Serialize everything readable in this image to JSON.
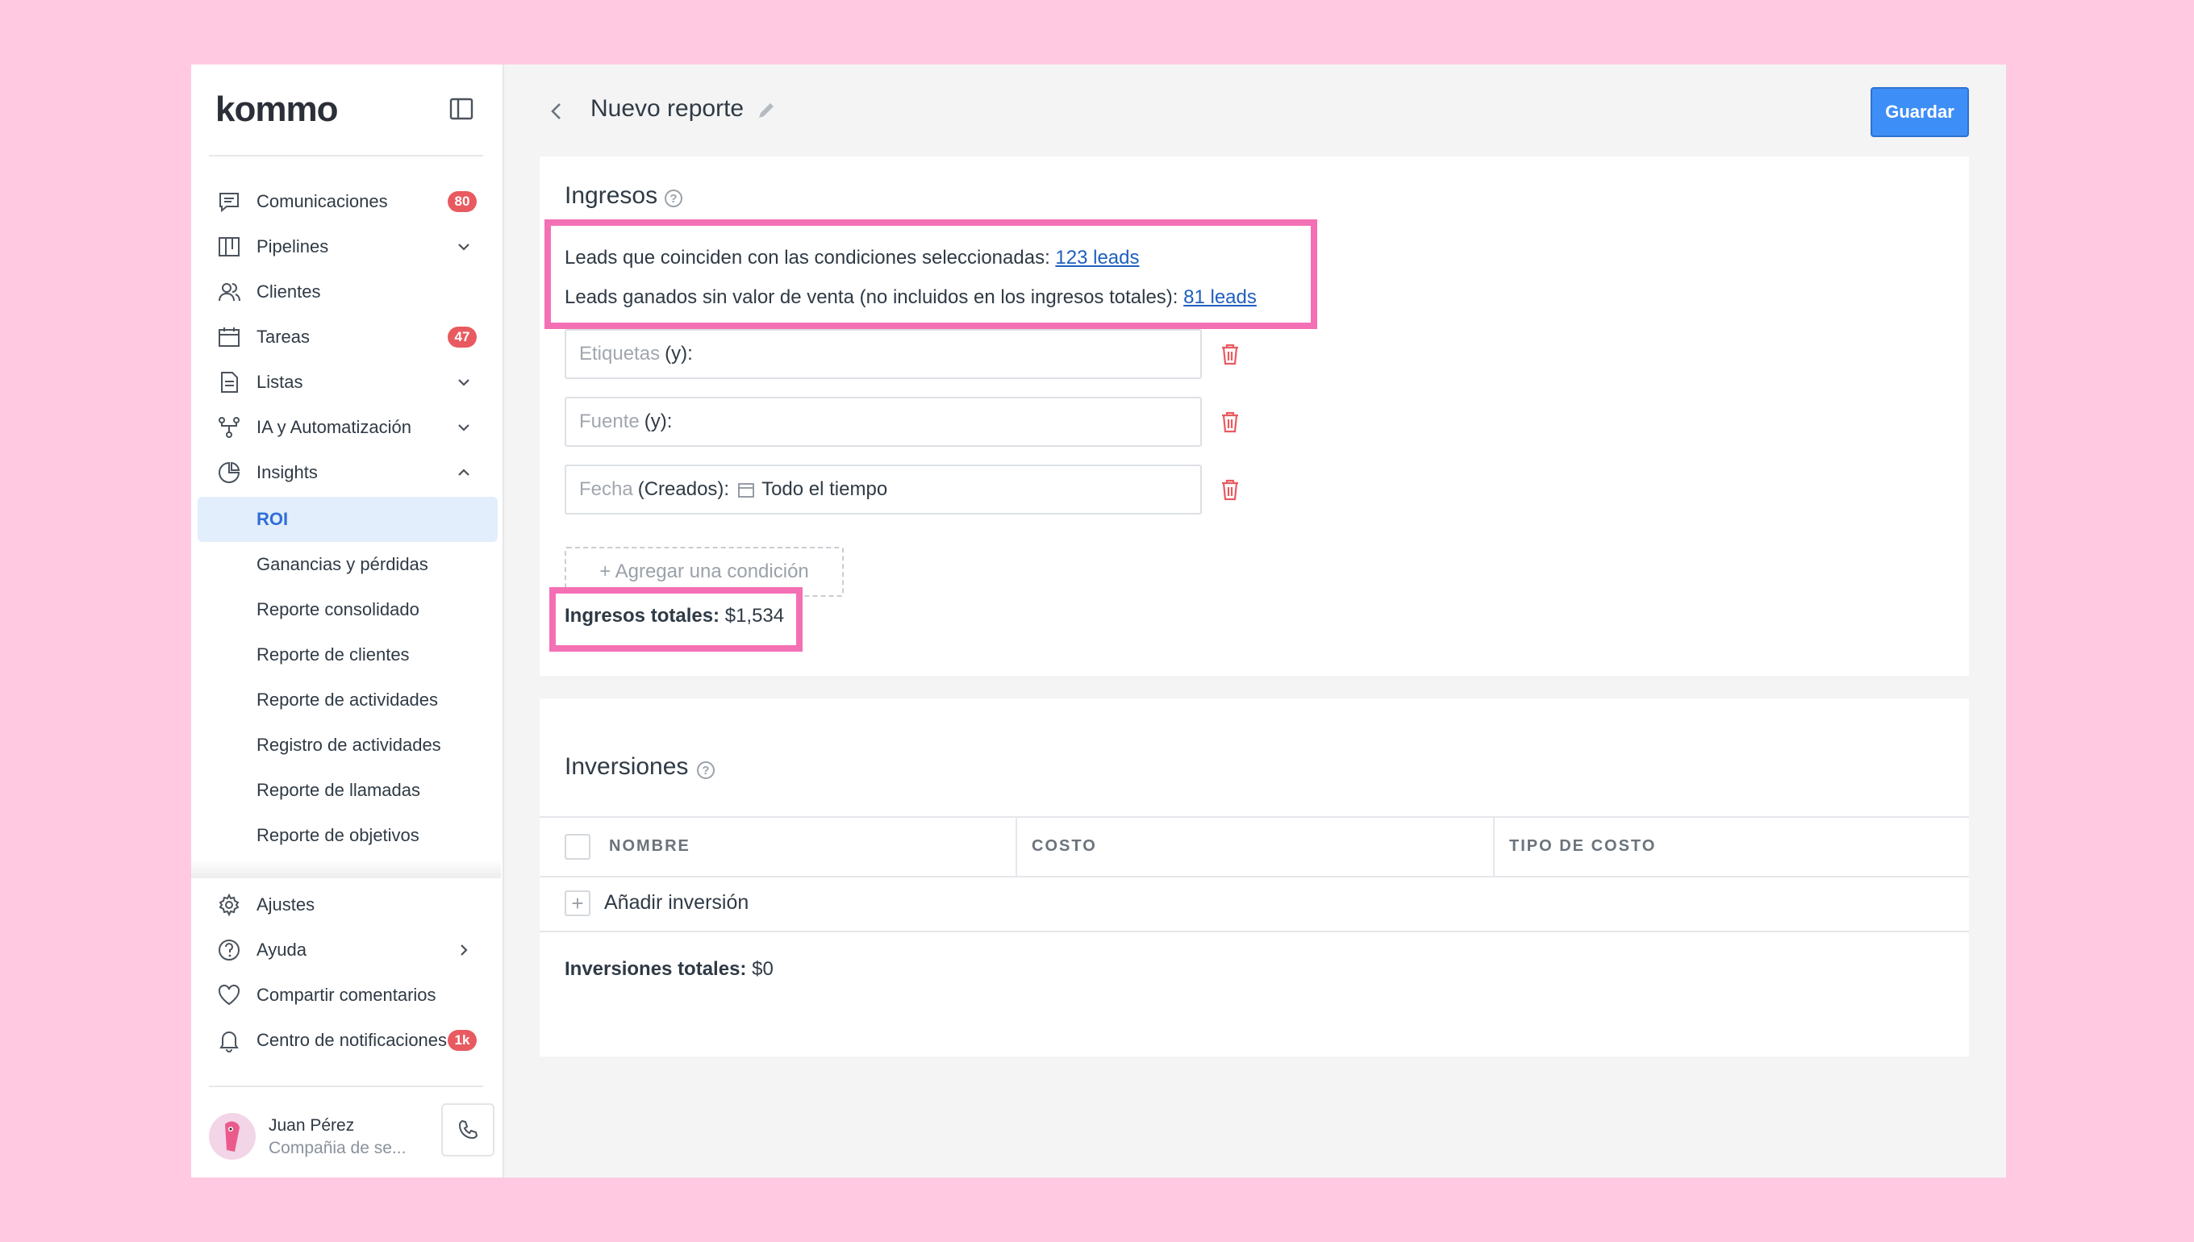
{
  "app": {
    "brand": "Kommo",
    "accent": "#3e8ef7",
    "highlight": "#f470b4",
    "badge_color": "#e85a5f"
  },
  "sidebar": {
    "items": [
      {
        "label": "Comunicaciones",
        "icon": "chat-icon",
        "badge": "80"
      },
      {
        "label": "Pipelines",
        "icon": "pipeline-icon",
        "chevron": "down"
      },
      {
        "label": "Clientes",
        "icon": "users-icon"
      },
      {
        "label": "Tareas",
        "icon": "calendar-icon",
        "badge": "47"
      },
      {
        "label": "Listas",
        "icon": "document-icon",
        "chevron": "down"
      },
      {
        "label": "IA y Automatización",
        "icon": "automation-icon",
        "chevron": "down"
      },
      {
        "label": "Insights",
        "icon": "pie-chart-icon",
        "chevron": "up"
      }
    ],
    "insights_sub": [
      {
        "label": "ROI",
        "active": true
      },
      {
        "label": "Ganancias y pérdidas"
      },
      {
        "label": "Reporte consolidado"
      },
      {
        "label": "Reporte de clientes"
      },
      {
        "label": "Reporte de actividades"
      },
      {
        "label": "Registro de actividades"
      },
      {
        "label": "Reporte de llamadas"
      },
      {
        "label": "Reporte de objetivos"
      }
    ],
    "bottom": [
      {
        "label": "Ajustes",
        "icon": "gear-icon"
      },
      {
        "label": "Ayuda",
        "icon": "help-icon",
        "chevron": "right"
      },
      {
        "label": "Compartir comentarios",
        "icon": "heart-icon"
      },
      {
        "label": "Centro de notificaciones",
        "icon": "bell-icon",
        "badge": "1k"
      }
    ],
    "user": {
      "name": "Juan Pérez",
      "company": "Compañia de se..."
    }
  },
  "header": {
    "title": "Nuevo reporte",
    "save_label": "Guardar"
  },
  "ingresos": {
    "title": "Ingresos",
    "line1_text": "Leads que coinciden con las condiciones seleccionadas: ",
    "line1_link": "123 leads",
    "line2_text": "Leads ganados sin valor de venta (no incluidos en los ingresos totales): ",
    "line2_link": "81 leads",
    "conditions": [
      {
        "placeholder": "Etiquetas",
        "qualifier": "(y):",
        "value": ""
      },
      {
        "placeholder": "Fuente",
        "qualifier": "(y):",
        "value": ""
      },
      {
        "placeholder": "Fecha",
        "qualifier": "(Creados):",
        "value": "Todo el tiempo"
      }
    ],
    "add_condition": "+ Agregar una condición",
    "total_label": "Ingresos totales:",
    "total_value": "$1,534"
  },
  "inversiones": {
    "title": "Inversiones",
    "columns": [
      "NOMBRE",
      "COSTO",
      "TIPO DE COSTO"
    ],
    "add_label": "Añadir inversión",
    "total_label": "Inversiones totales:",
    "total_value": "$0"
  }
}
